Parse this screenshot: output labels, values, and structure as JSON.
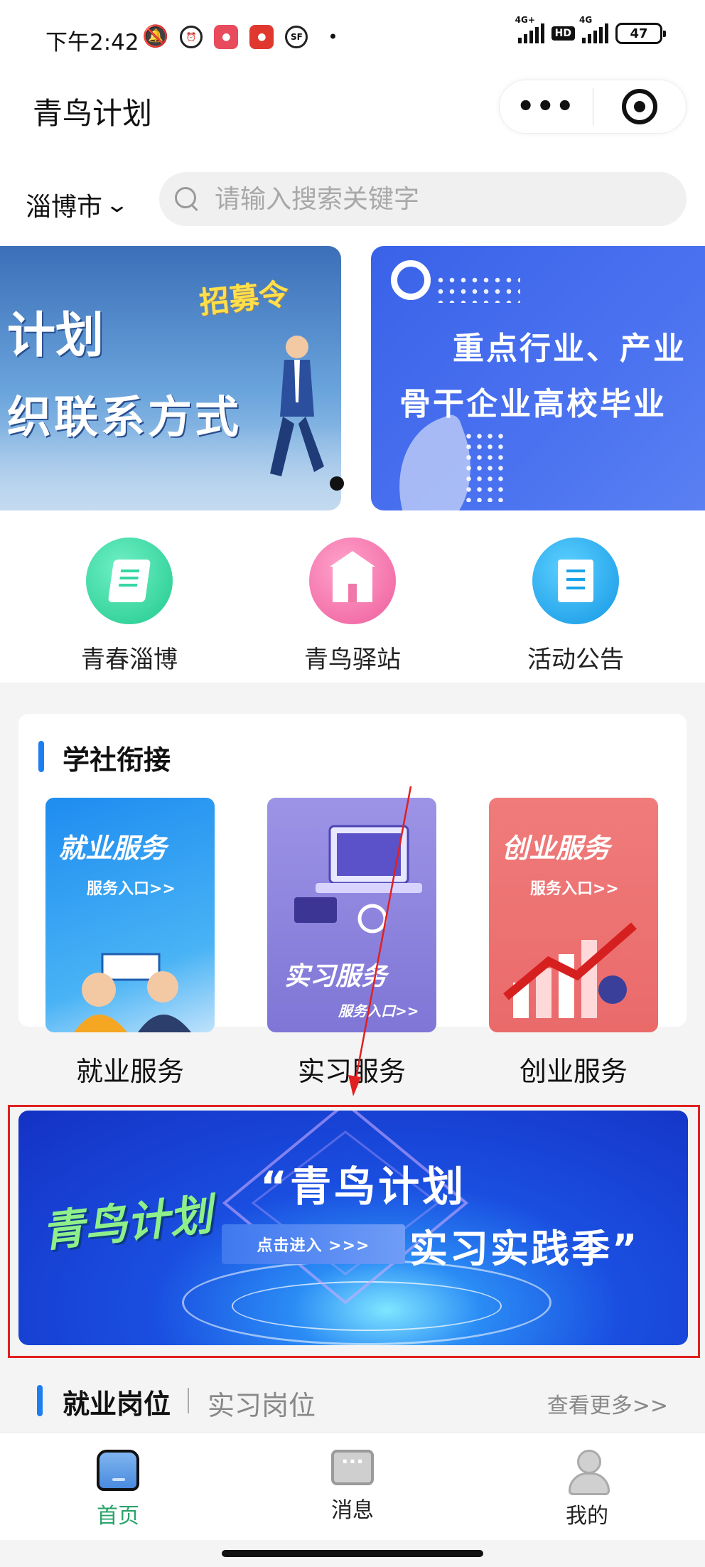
{
  "status_bar": {
    "time": "下午2:42",
    "network_1": "4G+",
    "hd": "HD",
    "network_2": "4G",
    "battery": "47"
  },
  "titlebar": {
    "title": "青鸟计划",
    "more_icon": "more-dots-icon",
    "close_icon": "target-record-icon"
  },
  "search": {
    "city": "淄博市",
    "placeholder": "请输入搜索关键字"
  },
  "banners": [
    {
      "line1": "计划",
      "line2": "织联系方式",
      "stamp": "招募令"
    },
    {
      "line1": "重点行业、产业",
      "line2": "骨干企业高校毕业"
    }
  ],
  "quick_nav": [
    {
      "label": "青春淄博",
      "icon": "book-icon",
      "color": "#2ad3a0"
    },
    {
      "label": "青鸟驿站",
      "icon": "building-icon",
      "color": "#f16aa6"
    },
    {
      "label": "活动公告",
      "icon": "document-icon",
      "color": "#17a3ea"
    }
  ],
  "section": {
    "title": "学社衔接",
    "services": [
      {
        "label": "就业服务",
        "card_title": "就业服务",
        "card_sub": "服务入口>>",
        "color": "#2a9ef0"
      },
      {
        "label": "实习服务",
        "card_title": "实习服务",
        "card_sub": "服务入口>>",
        "color": "#8e86de"
      },
      {
        "label": "创业服务",
        "card_title": "创业服务",
        "card_sub": "服务入口>>",
        "color": "#f07a7a"
      }
    ]
  },
  "promo": {
    "logo": "青鸟计划",
    "line1": "“青鸟计划",
    "line2": "实习实践季”",
    "button": "点击进入 >>>"
  },
  "jobs": {
    "tab_active": "就业岗位",
    "tab_inactive": "实习岗位",
    "more": "查看更多>>"
  },
  "tabbar": [
    {
      "label": "首页",
      "icon": "home-icon",
      "active": true
    },
    {
      "label": "消息",
      "icon": "message-icon",
      "active": false
    },
    {
      "label": "我的",
      "icon": "profile-icon",
      "active": false
    }
  ],
  "colors": {
    "accent": "#1d7ef2",
    "tab_active": "#2aa36a",
    "highlight_box": "#e02020"
  }
}
